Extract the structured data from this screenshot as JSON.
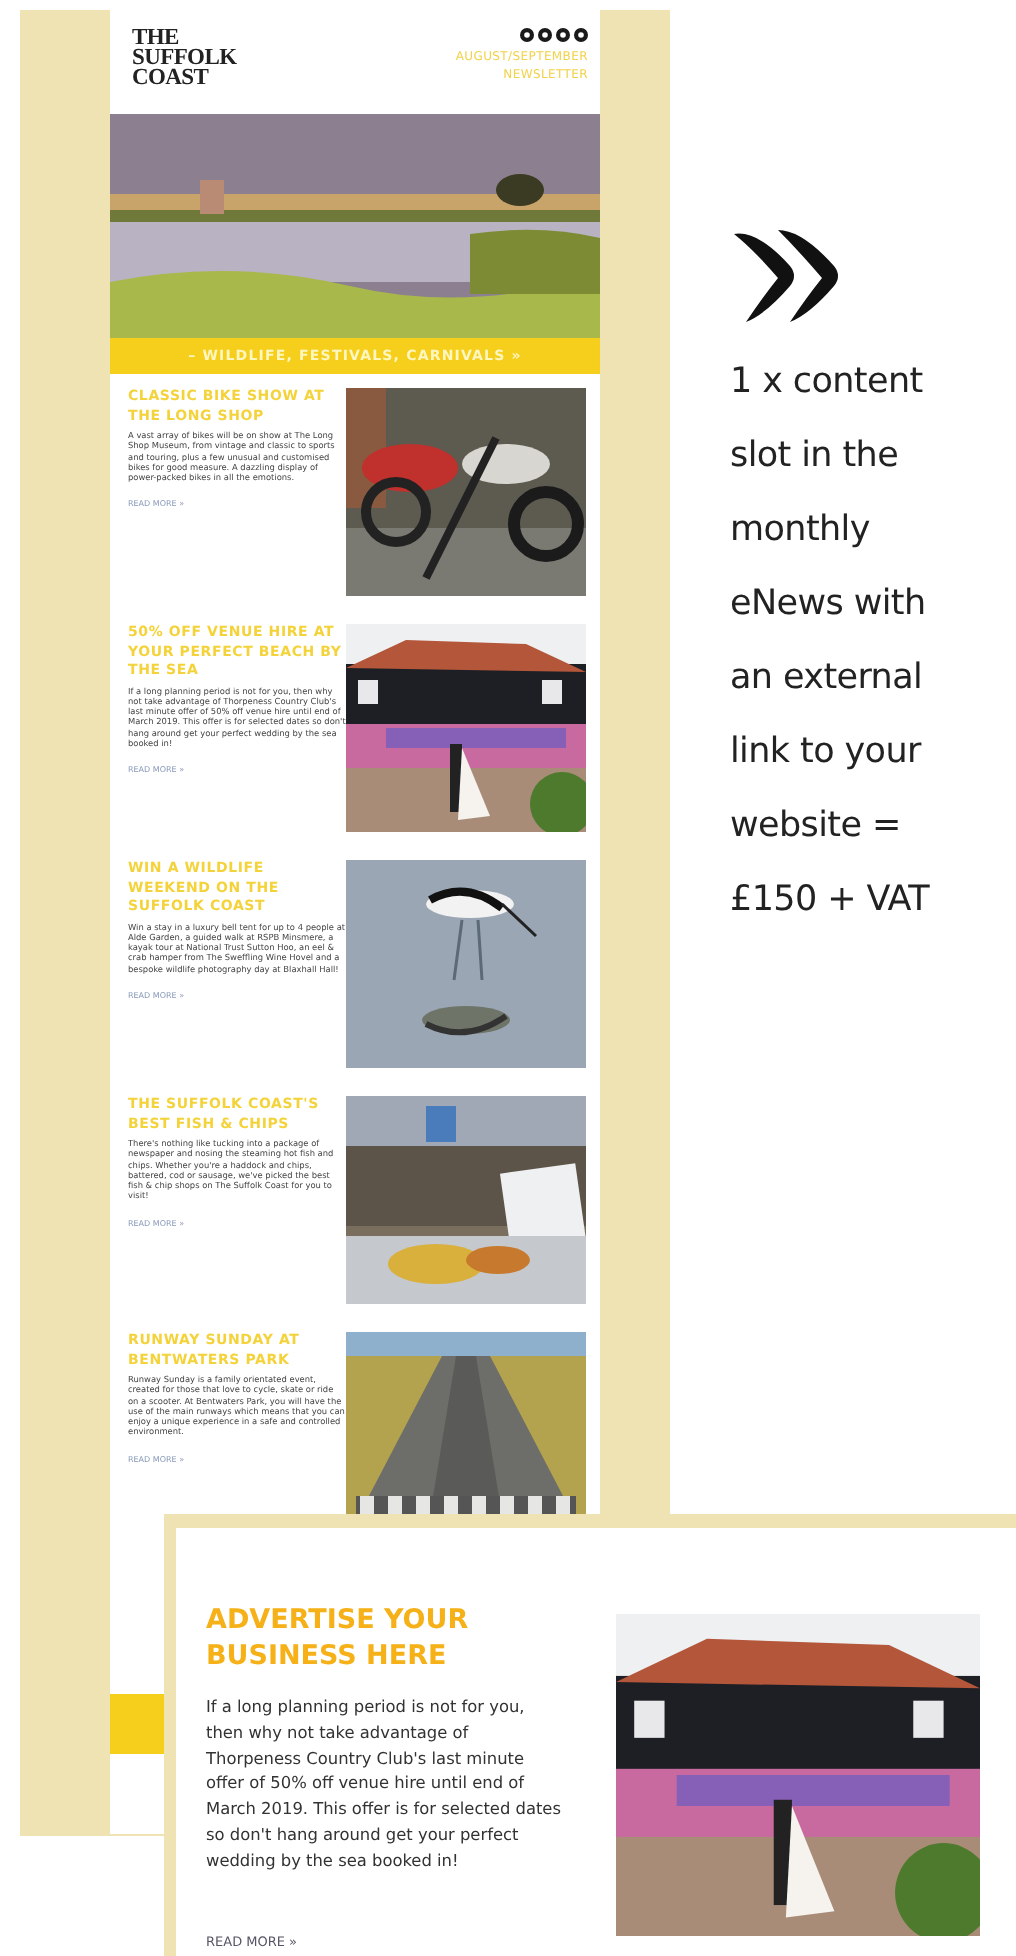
{
  "newsletter": {
    "logo_lines": [
      "THE",
      "SUFFOLK",
      "COAST"
    ],
    "issue": "AUGUST/SEPTEMBER NEWSLETTER",
    "banner": "– WILDLIFE, FESTIVALS, CARNIVALS »",
    "articles": [
      {
        "title": "CLASSIC BIKE SHOW AT THE LONG SHOP",
        "body": "A vast array of bikes will be on show at The Long Shop Museum, from vintage and classic to sports and touring, plus a few unusual and customised bikes for good measure. A dazzling display of power-packed bikes in all the emotions.",
        "link": "READ MORE »"
      },
      {
        "title": "50% OFF VENUE HIRE AT YOUR PERFECT BEACH BY THE SEA",
        "body": "If a long planning period is not for you, then why not take advantage of Thorpeness Country Club's last minute offer of 50% off venue hire until end of March 2019. This offer is for selected dates so don't hang around get your perfect wedding by the sea booked in!",
        "link": "READ MORE »"
      },
      {
        "title": "WIN A WILDLIFE WEEKEND ON THE SUFFOLK COAST",
        "body": "Win a stay in a luxury bell tent for up to 4 people at Alde Garden, a guided walk at RSPB Minsmere, a kayak tour at National Trust Sutton Hoo, an eel & crab hamper from The Sweffling Wine Hovel and a bespoke wildlife photography day at Blaxhall Hall!",
        "link": "READ MORE »"
      },
      {
        "title": "THE SUFFOLK COAST'S BEST FISH & CHIPS",
        "body": "There's nothing like tucking into a package of newspaper and nosing the steaming hot fish and chips. Whether you're a haddock and chips, battered, cod or sausage, we've picked the best fish & chip shops on The Suffolk Coast for you to visit!",
        "link": "READ MORE »"
      },
      {
        "title": "RUNWAY SUNDAY AT BENTWATERS PARK",
        "body": "Runway Sunday is a family orientated event, created for those that love to cycle, skate or ride on a scooter. At Bentwaters Park, you will have the use of the main runways which means that you can enjoy a unique experience in a safe and controlled environment.",
        "link": "READ MORE »"
      }
    ]
  },
  "offer": {
    "text": "1 x content slot in the monthly eNews with an external link to your website = £150 + VAT"
  },
  "ad": {
    "title": "ADVERTISE YOUR BUSINESS HERE",
    "body": "If a long planning period is not for you, then why not take advantage of Thorpeness Country Club's last minute offer of 50% off venue hire until end of March 2019. This offer is for selected dates so don't hang around get your perfect wedding by the sea booked in!",
    "link": "READ MORE »"
  }
}
